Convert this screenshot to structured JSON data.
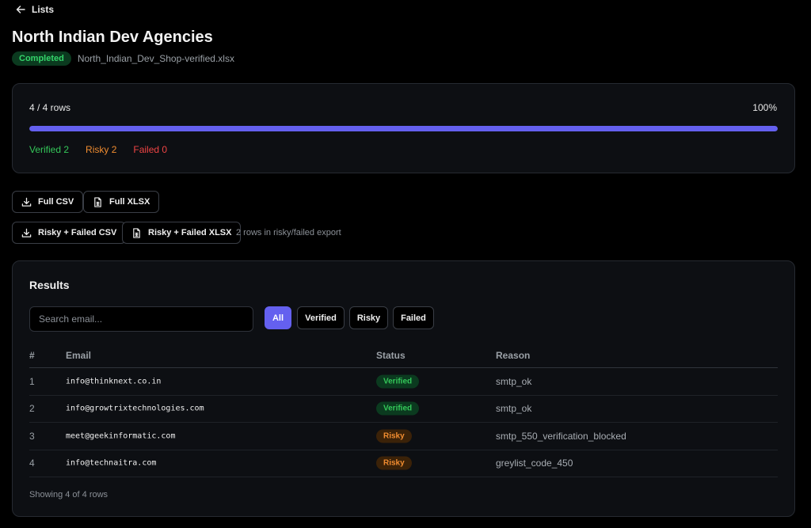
{
  "nav": {
    "back_label": "Lists"
  },
  "header": {
    "title": "North Indian Dev Agencies",
    "status": "Completed",
    "filename": "North_Indian_Dev_Shop-verified.xlsx"
  },
  "progress": {
    "rows_label": "4 / 4 rows",
    "percent_label": "100%",
    "fraction": 1.0,
    "verified_label": "Verified 2",
    "risky_label": "Risky 2",
    "failed_label": "Failed 0",
    "bar_color": "#6460ef"
  },
  "exports": {
    "full_csv": "Full CSV",
    "full_xlsx": "Full XLSX",
    "risky_failed_csv": "Risky + Failed CSV",
    "risky_failed_xlsx": "Risky + Failed XLSX",
    "note": "2 rows in risky/failed export"
  },
  "results": {
    "title": "Results",
    "search_placeholder": "Search email...",
    "filters": [
      "All",
      "Verified",
      "Risky",
      "Failed"
    ],
    "active_filter": "All",
    "columns": [
      "#",
      "Email",
      "Status",
      "Reason"
    ],
    "rows": [
      {
        "num": "1",
        "email": "info@thinknext.co.in",
        "status": "Verified",
        "reason": "smtp_ok"
      },
      {
        "num": "2",
        "email": "info@growtrixtechnologies.com",
        "status": "Verified",
        "reason": "smtp_ok"
      },
      {
        "num": "3",
        "email": "meet@geekinformatic.com",
        "status": "Risky",
        "reason": "smtp_550_verification_blocked"
      },
      {
        "num": "4",
        "email": "info@technaitra.com",
        "status": "Risky",
        "reason": "greylist_code_450"
      }
    ],
    "footer": "Showing 4 of 4 rows"
  },
  "icons": {
    "back": "arrow-left-icon",
    "download": "download-icon",
    "spreadsheet": "spreadsheet-file-icon"
  }
}
